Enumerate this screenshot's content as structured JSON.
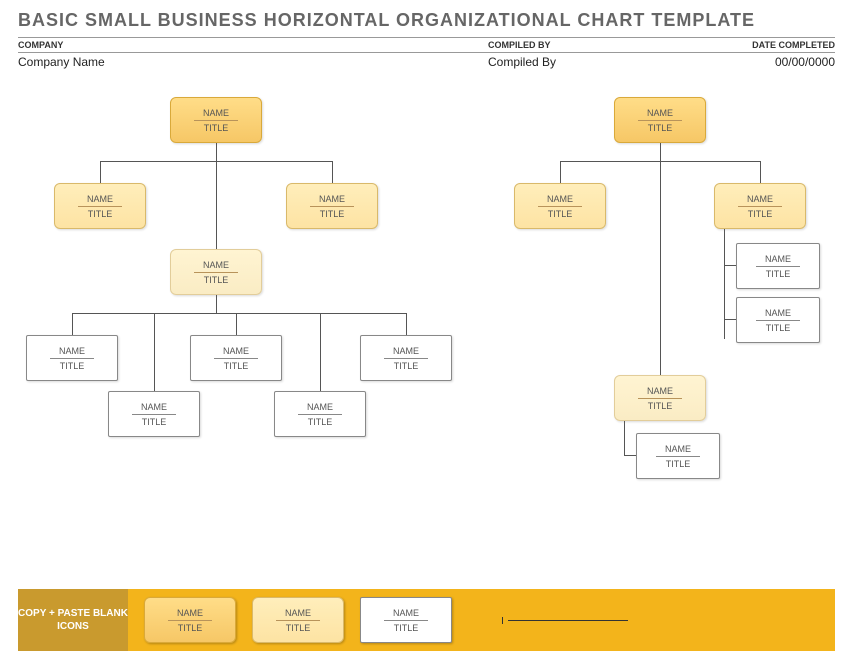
{
  "header": {
    "title": "BASIC SMALL BUSINESS HORIZONTAL ORGANIZATIONAL CHART TEMPLATE",
    "labels": {
      "company": "COMPANY",
      "compiled_by": "COMPILED BY",
      "date_completed": "DATE COMPLETED"
    },
    "values": {
      "company": "Company Name",
      "compiled_by": "Compiled By",
      "date_completed": "00/00/0000"
    }
  },
  "node_text": {
    "name": "NAME",
    "title": "TITLE"
  },
  "footer": {
    "label": "COPY + PASTE BLANK ICONS"
  },
  "org_structure": {
    "left_tree": {
      "root": {
        "style": "y1"
      },
      "level2": [
        {
          "style": "y2"
        },
        {
          "style": "y2"
        }
      ],
      "level3_center": {
        "style": "y3"
      },
      "level4": [
        {
          "style": "plain"
        },
        {
          "style": "plain"
        },
        {
          "style": "plain"
        }
      ],
      "level5": [
        {
          "style": "plain"
        },
        {
          "style": "plain"
        }
      ]
    },
    "right_tree": {
      "root": {
        "style": "y1"
      },
      "level2": [
        {
          "style": "y2"
        },
        {
          "style": "y2"
        }
      ],
      "right_chain": [
        {
          "style": "plain"
        },
        {
          "style": "plain"
        }
      ],
      "bottom_center": {
        "style": "y3"
      },
      "bottom_leaf": {
        "style": "plain"
      }
    }
  },
  "palette_samples": [
    {
      "style": "y1"
    },
    {
      "style": "y2"
    },
    {
      "style": "plain"
    }
  ]
}
